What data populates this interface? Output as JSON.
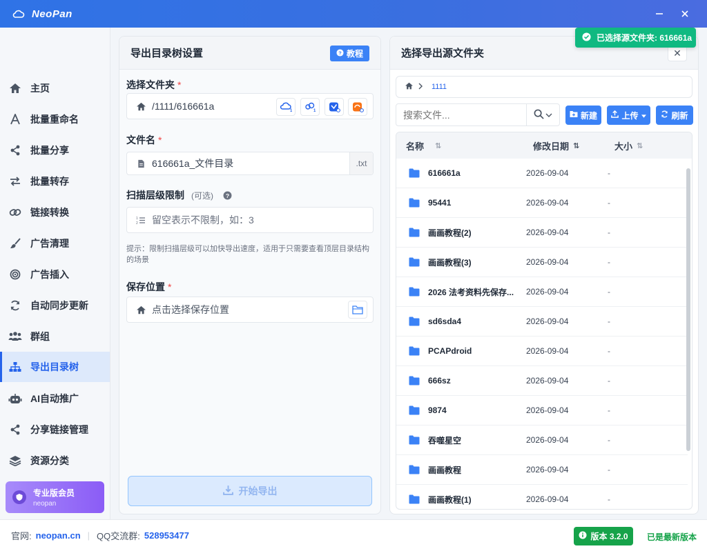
{
  "app": {
    "title": "NeoPan"
  },
  "sidebar": {
    "items": [
      {
        "label": "主页",
        "icon": "home-icon"
      },
      {
        "label": "批量重命名",
        "icon": "font-icon"
      },
      {
        "label": "批量分享",
        "icon": "share-icon"
      },
      {
        "label": "批量转存",
        "icon": "transfer-icon"
      },
      {
        "label": "链接转换",
        "icon": "link-icon"
      },
      {
        "label": "广告清理",
        "icon": "brush-icon"
      },
      {
        "label": "广告插入",
        "icon": "target-icon"
      },
      {
        "label": "自动同步更新",
        "icon": "sync-icon"
      },
      {
        "label": "群组",
        "icon": "users-icon"
      },
      {
        "label": "导出目录树",
        "icon": "sitemap-icon",
        "active": true
      },
      {
        "label": "AI自动推广",
        "icon": "robot-icon"
      },
      {
        "label": "分享链接管理",
        "icon": "share-icon"
      },
      {
        "label": "资源分类",
        "icon": "layers-icon"
      }
    ],
    "pro": {
      "title": "专业版会员",
      "subtitle": "neopan"
    }
  },
  "left": {
    "title": "导出目录树设置",
    "tutorial": "教程",
    "folder_label": "选择文件夹",
    "folder_value": "/1111/616661a",
    "filename_label": "文件名",
    "filename_value": "616661a_文件目录",
    "filename_suffix": ".txt",
    "scan_label": "扫描层级限制",
    "scan_optional": "(可选)",
    "scan_placeholder": "留空表示不限制，如：3",
    "hint": "提示：限制扫描层级可以加快导出速度，适用于只需要查看顶层目录结构的场景",
    "save_label": "保存位置",
    "save_placeholder": "点击选择保存位置",
    "export_button": "开始导出",
    "required_mark": "*"
  },
  "right": {
    "title": "选择导出源文件夹",
    "close": "✕",
    "breadcrumb": "1111",
    "search_placeholder": "搜索文件...",
    "new_button": "新建",
    "upload_button": "上传",
    "refresh_button": "刷新",
    "columns": {
      "name": "名称",
      "date": "修改日期",
      "size": "大小"
    },
    "rows": [
      {
        "name": "616661a",
        "date": "2026-09-04",
        "size": "-"
      },
      {
        "name": "95441",
        "date": "2026-09-04",
        "size": "-"
      },
      {
        "name": "画画教程(2)",
        "date": "2026-09-04",
        "size": "-"
      },
      {
        "name": "画画教程(3)",
        "date": "2026-09-04",
        "size": "-"
      },
      {
        "name": "2026 法考资料先保存...",
        "date": "2026-09-04",
        "size": "-"
      },
      {
        "name": "sd6sda4",
        "date": "2026-09-04",
        "size": "-"
      },
      {
        "name": "PCAPdroid",
        "date": "2026-09-04",
        "size": "-"
      },
      {
        "name": "666sz",
        "date": "2026-09-04",
        "size": "-"
      },
      {
        "name": "9874",
        "date": "2026-09-04",
        "size": "-"
      },
      {
        "name": "吞噬星空",
        "date": "2026-09-04",
        "size": "-"
      },
      {
        "name": "画画教程",
        "date": "2026-09-04",
        "size": "-"
      },
      {
        "name": "画画教程(1)",
        "date": "2026-09-04",
        "size": "-"
      }
    ]
  },
  "toast": {
    "text": "已选择源文件夹: 616661a"
  },
  "footer": {
    "site_label": "官网:",
    "site": "neopan.cn",
    "qq_label": "QQ交流群:",
    "qq": "528953477",
    "version": "版本 3.2.0",
    "latest": "已是最新版本"
  },
  "colors": {
    "accent": "#3b82f6",
    "success": "#16a34a",
    "toast": "#10b981",
    "folder": "#3b82f6"
  }
}
